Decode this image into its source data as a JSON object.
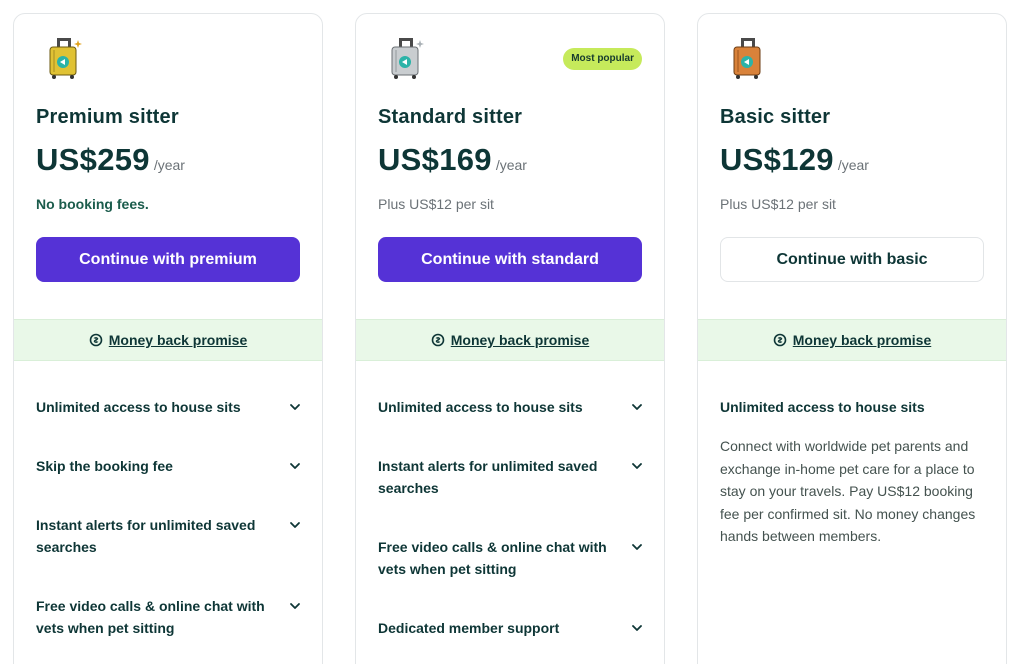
{
  "plans": [
    {
      "title": "Premium sitter",
      "price": "US$259",
      "period": "/year",
      "note": "No booking fees.",
      "cta": "Continue with premium",
      "promise": "Money back promise",
      "features": [
        "Unlimited access to house sits",
        "Skip the booking fee",
        "Instant alerts for unlimited saved searches",
        "Free video calls & online chat with vets when pet sitting"
      ],
      "luggage_color": "#e0c234"
    },
    {
      "title": "Standard sitter",
      "price": "US$169",
      "period": "/year",
      "badge": "Most popular",
      "note": "Plus US$12 per sit",
      "cta": "Continue with standard",
      "promise": "Money back promise",
      "features": [
        "Unlimited access to house sits",
        "Instant alerts for unlimited saved searches",
        "Free video calls & online chat with vets when pet sitting",
        "Dedicated member support"
      ],
      "luggage_color": "#c9cdd0"
    },
    {
      "title": "Basic sitter",
      "price": "US$129",
      "period": "/year",
      "note": "Plus US$12 per sit",
      "cta": "Continue with basic",
      "promise": "Money back promise",
      "features": [
        "Unlimited access to house sits"
      ],
      "description": "Connect with worldwide pet parents and exchange in-home pet care for a place to stay on your travels. Pay US$12 booking fee per confirmed sit. No money changes hands between members.",
      "luggage_color": "#d9823a"
    }
  ],
  "colors": {
    "primary_button": "#5532d6",
    "promise_band": "#e9f8e8",
    "badge": "#c6ea5b",
    "text_dark": "#0e3636"
  }
}
